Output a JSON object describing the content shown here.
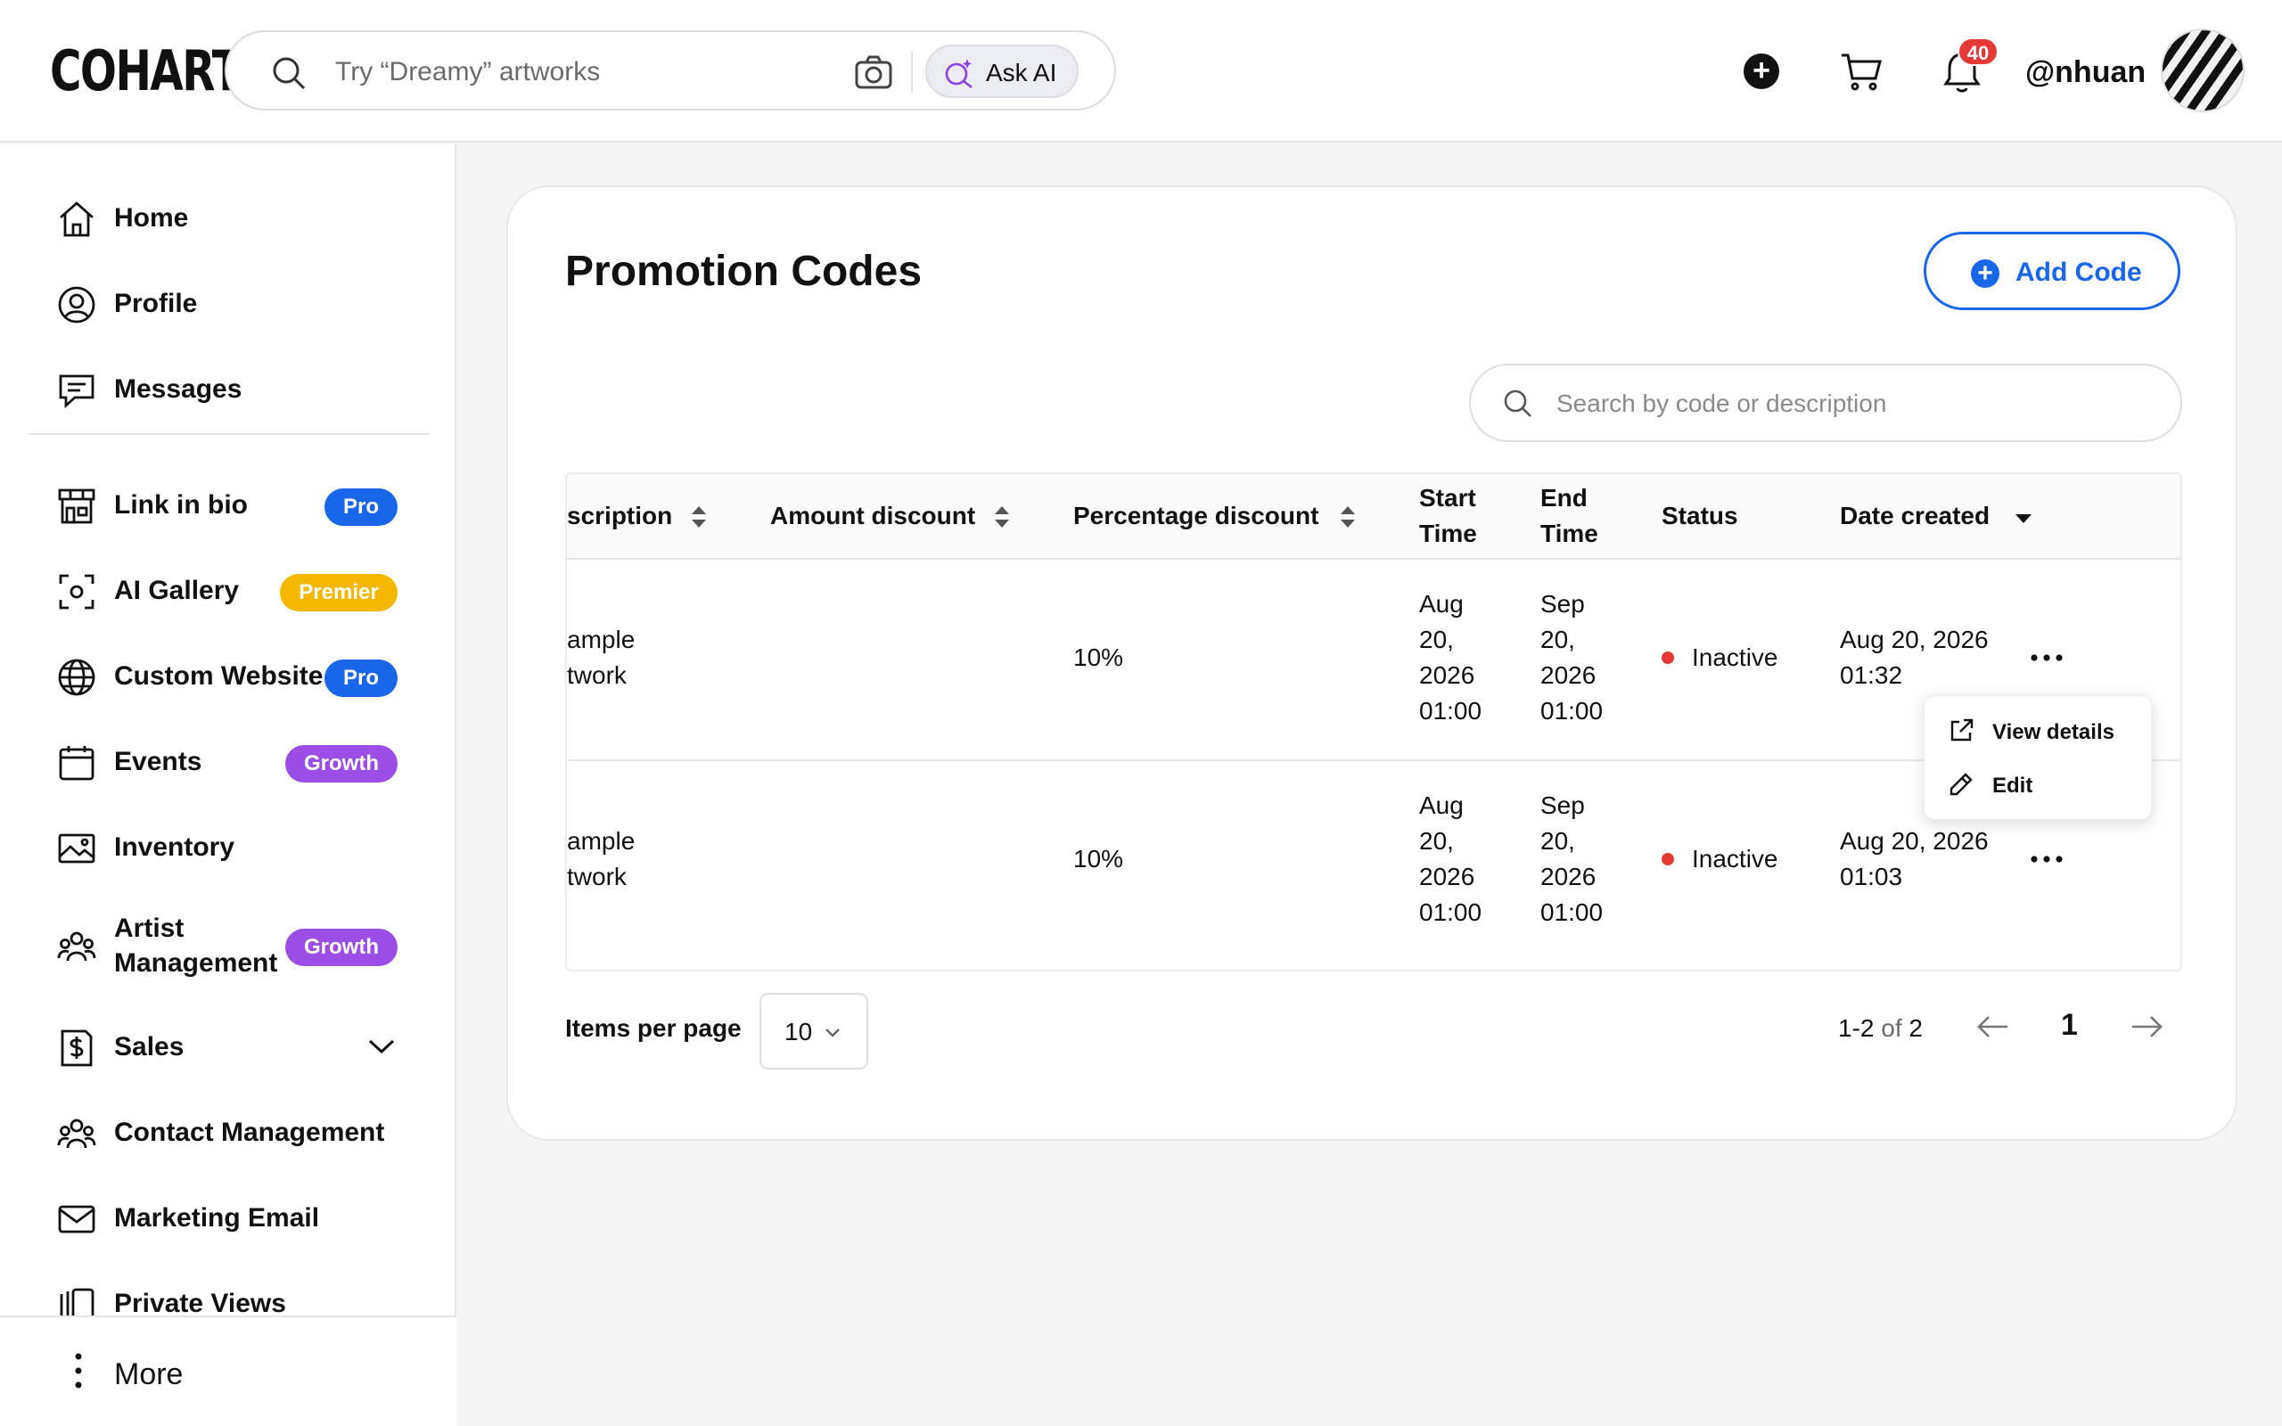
{
  "header": {
    "logo": "COHART",
    "search_placeholder": "Try “Dreamy” artworks",
    "ask_ai_label": "Ask AI",
    "notification_count": "40",
    "username": "@nhuan"
  },
  "sidebar": {
    "items": [
      {
        "label": "Home",
        "icon": "home-icon"
      },
      {
        "label": "Profile",
        "icon": "profile-icon"
      },
      {
        "label": "Messages",
        "icon": "messages-icon"
      },
      {
        "label": "Link in bio",
        "icon": "store-icon",
        "badge": "Pro",
        "badge_color": "#1a66e8"
      },
      {
        "label": "AI Gallery",
        "icon": "scan-icon",
        "badge": "Premier",
        "badge_color": "#f5b800"
      },
      {
        "label": "Custom Website",
        "icon": "globe-icon",
        "badge": "Pro",
        "badge_color": "#1a66e8"
      },
      {
        "label": "Events",
        "icon": "calendar-icon",
        "badge": "Growth",
        "badge_color": "#9b4de6"
      },
      {
        "label": "Inventory",
        "icon": "image-icon"
      },
      {
        "label": "Artist Management",
        "icon": "team-icon",
        "badge": "Growth",
        "badge_color": "#9b4de6"
      },
      {
        "label": "Sales",
        "icon": "dollar-icon"
      },
      {
        "label": "Contact Management",
        "icon": "contacts-icon"
      },
      {
        "label": "Marketing Email",
        "icon": "mail-icon"
      },
      {
        "label": "Private Views",
        "icon": "slides-icon"
      }
    ],
    "more_label": "More"
  },
  "main": {
    "title": "Promotion Codes",
    "add_button_label": "Add Code",
    "search_placeholder": "Search by code or description",
    "columns": {
      "description": "scription",
      "amount_discount": "Amount discount",
      "percentage_discount": "Percentage discount",
      "start_time_1": "Start",
      "start_time_2": "Time",
      "end_time_1": "End",
      "end_time_2": "Time",
      "status": "Status",
      "date_created": "Date created"
    },
    "rows": [
      {
        "description_1": "ample",
        "description_2": "twork",
        "amount_discount": "",
        "percentage_discount": "10%",
        "start_1": "Aug",
        "start_2": "20,",
        "start_3": "2026",
        "start_4": "01:00",
        "end_1": "Sep",
        "end_2": "20,",
        "end_3": "2026",
        "end_4": "01:00",
        "status": "Inactive",
        "created_1": "Aug 20, 2026",
        "created_2": "01:32"
      },
      {
        "description_1": "ample",
        "description_2": "twork",
        "amount_discount": "",
        "percentage_discount": "10%",
        "start_1": "Aug",
        "start_2": "20,",
        "start_3": "2026",
        "start_4": "01:00",
        "end_1": "Sep",
        "end_2": "20,",
        "end_3": "2026",
        "end_4": "01:00",
        "status": "Inactive",
        "created_1": "Aug 20, 2026",
        "created_2": "01:03"
      }
    ],
    "row_menu": {
      "view_details": "View details",
      "edit": "Edit"
    },
    "pagination": {
      "items_per_page_label": "Items per page",
      "items_per_page_value": "10",
      "range": "1-2",
      "of_label": "of",
      "total": "2",
      "current_page": "1"
    }
  },
  "colors": {
    "accent": "#1a66e8",
    "status_inactive": "#e53935",
    "badge_pro": "#1a66e8",
    "badge_premier": "#f5b800",
    "badge_growth": "#9b4de6"
  }
}
